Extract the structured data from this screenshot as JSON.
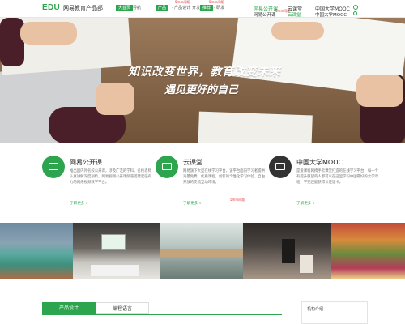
{
  "header": {
    "logo": "EDU",
    "dept": "网易教育产品部",
    "chip1": "大首页",
    "chip1_sub": "导航",
    "chip2": "产品",
    "chip2_items": [
      "· 产品设计",
      "· 开发",
      "· 研发"
    ],
    "chip3": "推荐",
    "nav_top": [
      "网易公开课",
      "云课堂",
      "中国大学MOOC"
    ],
    "nav_bottom": [
      "网易公开课",
      "云课堂",
      "中国大学MOOC"
    ],
    "red_notes": [
      "5mm间距",
      "5mm间距",
      "5mm间距"
    ]
  },
  "hero": {
    "title": "知识改变世界，教育改变未来",
    "subtitle": "遇见更好的自己"
  },
  "products": [
    {
      "name": "网易公开课",
      "desc": "推出国内外名校公开课，涉及广泛的学科，名校老师认真讲解深度剖析，网易视频公开课频道搭建起强有力的网络视频教学平台。",
      "more": "了解更多 >"
    },
    {
      "name": "云课堂",
      "desc": "网易旗下大型在线学习平台，该平台面向学习者提供海量免费、优质课程，创新的个性化学习体验，自由开放的交流互动环境。",
      "more": "了解更多 >",
      "note": "5mm间距"
    },
    {
      "name": "中国大学MOOC",
      "desc": "是爱课程网携手云课堂打造的在线学习平台，每一个有提升愿望的人都可以在这里学习中国最好的大学课程，学完还能获得认证证书。",
      "more": "了解更多 >"
    }
  ],
  "tabs": [
    "产品设计",
    "编程语言"
  ],
  "about_title": "机构介绍",
  "colors": {
    "accent": "#2da44e",
    "hero_text": "#ffffff"
  }
}
